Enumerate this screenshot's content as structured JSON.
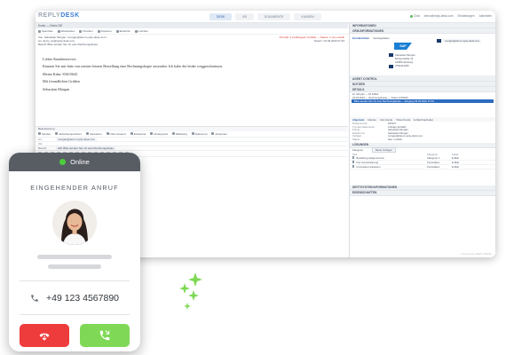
{
  "app": {
    "logo_a": "REPLY",
    "logo_b": "DESK",
    "tabs": [
      "DESK",
      "KB",
      "DOKUMENTE",
      "KUNDEN"
    ],
    "topright": [
      "Chat",
      "demo@reply-desk.com",
      "Einstellungen",
      "Abmelden"
    ],
    "topright2": [
      "Message Board",
      "Adminboard"
    ]
  },
  "ticket": {
    "header": "Konto — Demo DE",
    "toolbar": [
      "Sperrliste",
      "Weiterleiten",
      "Drucken",
      "Kopieren",
      "Entwürfe",
      "Löschen"
    ],
    "from_label": "Von:",
    "from": "Sebastian Morgan <morgan@demo.reply-desk.com>",
    "to_label": "An:",
    "to": "demo_de@reply-desk.com",
    "subject_label": "Betreff:",
    "subject": "Bitte senden Sie mir eine Rechnungskopie",
    "status": "Priorität: 3 (Auftragsart: E-Mail) — Status: 1 neu erstellt",
    "date": "Datum: 03.03.2022 07:34",
    "body": [
      "Liebes Kundenservice,",
      "Können Sie mir bitte von meiner letzten Bestellung eine Rechnungskopie zusenden. Ich habe die leider weggeschmissen.",
      "Meine Kdnr: 83615643",
      "Mit freundlichen Grüßen",
      "Sebastian Morgan"
    ]
  },
  "reply": {
    "tab": "Beantwortung",
    "actions": [
      "Senden",
      "Zwischenspeichern",
      "Verwerfen",
      "Ohne Antwort",
      "Erweiterte",
      "Hintergrund",
      "Mitteilung",
      "Dokument",
      "Antworten"
    ],
    "to_label": "An:",
    "to": "morgan@demo.reply-desk.com",
    "cc_label": "CC:",
    "subject_label": "Betreff:",
    "subject": "AW: Bitte senden Sie mir eine Rechnungskopie",
    "footer": "Powered by REPLYDESK"
  },
  "sidebar": {
    "info_title": "INFORMATIONEN",
    "crm_title": "CRM-INFORMATIONEN",
    "crm_tabs": [
      "Kundendaten",
      "Vertragsdaten"
    ],
    "crm_name": "Sebastian Morgan",
    "crm_street": "Musterstraße 12",
    "crm_city": "22085 Hamburg",
    "crm_phone": "0781441405",
    "crm_email": "morgan@demo.reply-desk.com",
    "sap_label": "SAP",
    "agent_title": "AGENT CONTROL",
    "notes_title": "NOTIZEN",
    "details_title": "DETAILS",
    "details_rows": [
      "Hr. Morgan — ID 34811",
      "03.03.2022 — Rechnungskopie — Ticket 1478426"
    ],
    "details_highlight": "Bitte senden Sie mir eine Rechnungskopie — Eingang 03.03.2022 07:34",
    "subtabs": [
      "Allgemein",
      "Historie",
      "Crm-Kunde",
      "Ticket Kunde",
      "E-Mail Kopfzeilen"
    ],
    "kv": [
      [
        "Dokument-ID",
        "185127"
      ],
      [
        "Typ des Dokuments",
        "Anfrage (E-Mail)"
      ],
      [
        "Kunde",
        "Sebastian Morgan"
      ],
      [
        "Erstellt von",
        "Sebastian Morgan"
      ],
      [
        "Verfasst",
        "morgan@demo.reply-desk.com"
      ],
      [
        "Status",
        "Neu / erstellt"
      ]
    ],
    "solutions_title": "LÖSUNGEN",
    "solutions_left": "Kategorie",
    "solutions_right": "Beste Vorlagen",
    "solutions_head": [
      "Titel",
      "Kategorie",
      "Kanal"
    ],
    "solutions": [
      [
        "Bestellung aufgenommen",
        "Kategorie 1",
        "E-Mail"
      ],
      [
        "Ihre Kontoänderung",
        "Kontodaten",
        "E-Mail"
      ],
      [
        "Kontostand anpassen",
        "Kontodaten",
        "E-Mail"
      ]
    ],
    "third_title": "DRITTSYSTEM INFORMATIONEN",
    "props_title": "EIGENSCHAFTEN"
  },
  "phone": {
    "status": "Online",
    "incoming": "EINGEHENDER ANRUF",
    "number": "+49 123 4567890"
  },
  "colors": {
    "online": "#4ccd3a",
    "decline": "#ee3b3b",
    "accept": "#7fd957",
    "header": "#585d64"
  }
}
